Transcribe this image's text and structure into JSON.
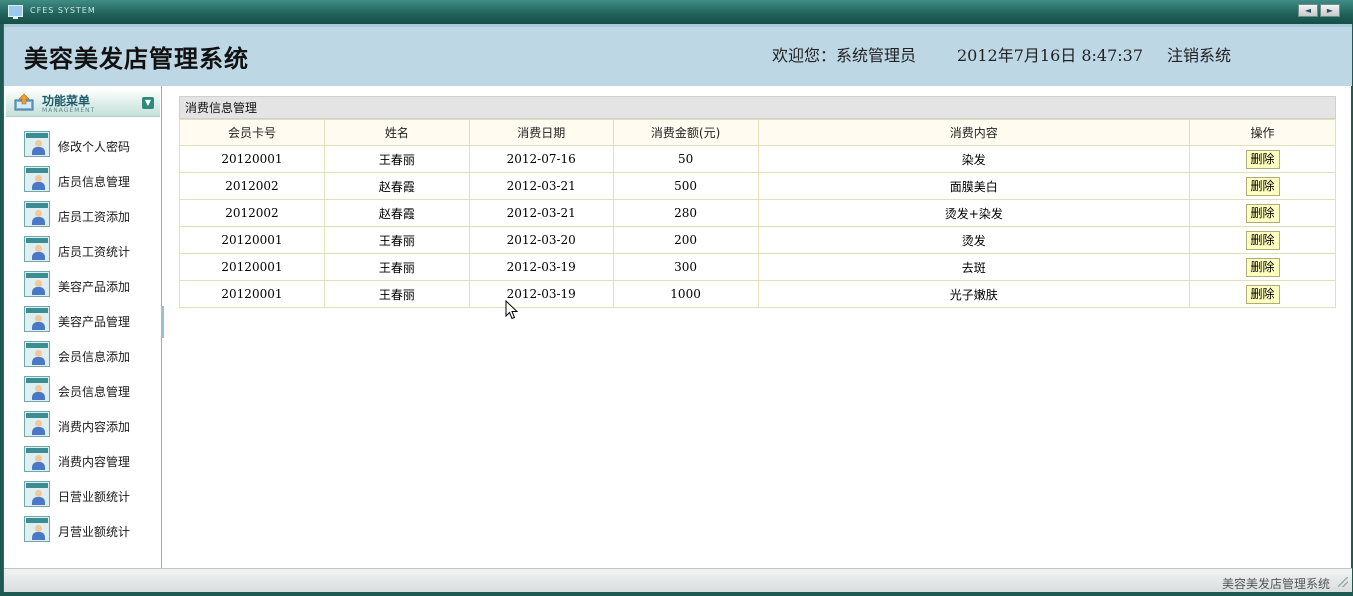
{
  "titlebar": {
    "app_name": "CFES SYSTEM",
    "prev_symbol": "◄",
    "next_symbol": "►"
  },
  "header": {
    "system_title": "美容美发店管理系统",
    "welcome": "欢迎您：系统管理员",
    "datetime": "2012年7月16日  8:47:37",
    "logout": "注销系统"
  },
  "sidebar": {
    "menu_title": "功能菜单",
    "menu_subtitle": "MANAGEMENT",
    "items": [
      {
        "label": "修改个人密码"
      },
      {
        "label": "店员信息管理"
      },
      {
        "label": "店员工资添加"
      },
      {
        "label": "店员工资统计"
      },
      {
        "label": "美容产品添加"
      },
      {
        "label": "美容产品管理"
      },
      {
        "label": "会员信息添加"
      },
      {
        "label": "会员信息管理"
      },
      {
        "label": "消费内容添加"
      },
      {
        "label": "消费内容管理"
      },
      {
        "label": "日营业额统计"
      },
      {
        "label": "月营业额统计"
      }
    ]
  },
  "main": {
    "panel_title": "消费信息管理",
    "columns": [
      "会员卡号",
      "姓名",
      "消费日期",
      "消费金额(元)",
      "消费内容",
      "操作"
    ],
    "rows": [
      {
        "card": "20120001",
        "name": "王春丽",
        "date": "2012-07-16",
        "amount": "50",
        "content": "染发",
        "action": "删除"
      },
      {
        "card": "2012002",
        "name": "赵春霞",
        "date": "2012-03-21",
        "amount": "500",
        "content": "面膜美白",
        "action": "删除"
      },
      {
        "card": "2012002",
        "name": "赵春霞",
        "date": "2012-03-21",
        "amount": "280",
        "content": "烫发+染发",
        "action": "删除"
      },
      {
        "card": "20120001",
        "name": "王春丽",
        "date": "2012-03-20",
        "amount": "200",
        "content": "烫发",
        "action": "删除"
      },
      {
        "card": "20120001",
        "name": "王春丽",
        "date": "2012-03-19",
        "amount": "300",
        "content": "去斑",
        "action": "删除"
      },
      {
        "card": "20120001",
        "name": "王春丽",
        "date": "2012-03-19",
        "amount": "1000",
        "content": "光子嫩肤",
        "action": "删除"
      }
    ]
  },
  "footer": {
    "text": "美容美发店管理系统"
  }
}
